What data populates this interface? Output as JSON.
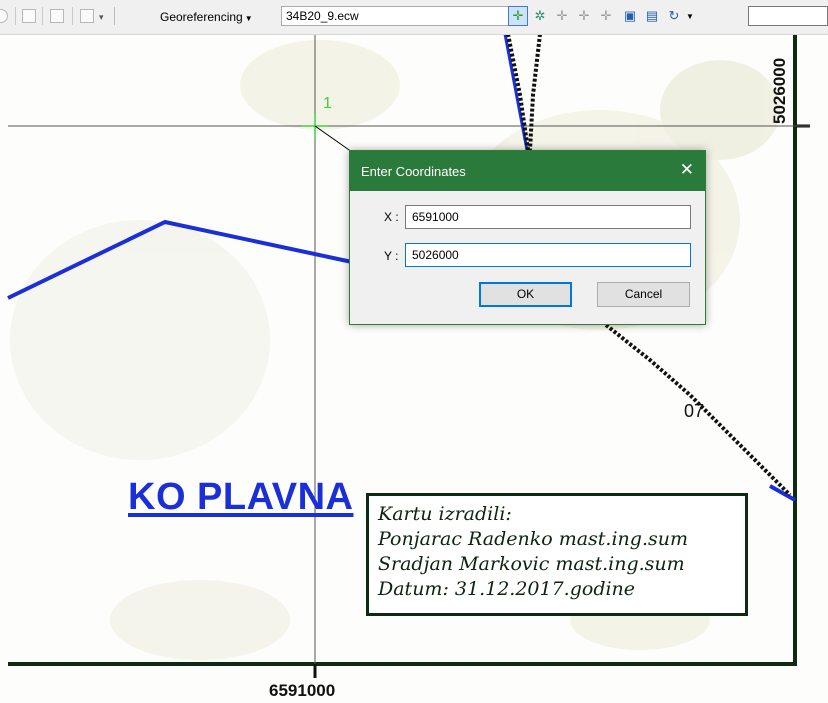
{
  "toolbar": {
    "georeferencing_label": "Georeferencing",
    "layer_combo_value": "34B20_9.ecw",
    "coordinate_box_value": ""
  },
  "map": {
    "y_coordinate_label": "5026000",
    "x_coordinate_label": "6591000",
    "control_point_label": "1",
    "road_number_label": "07",
    "area_title": "KO PLAVNA",
    "credits": {
      "line1": "Kartu izradili:",
      "line2": "Ponjarac Radenko mast.ing.sum",
      "line3": "Sradjan Markovic mast.ing.sum",
      "line4": "Datum: 31.12.2017.godine"
    },
    "colors": {
      "road_blue": "#1b2fd8",
      "frame_green": "#0d2a12",
      "control_point_green": "#3fd13f"
    }
  },
  "dialog": {
    "title": "Enter Coordinates",
    "x_label": "X :",
    "x_value": "6591000",
    "y_label": "Y :",
    "y_value": "5026000",
    "ok_label": "OK",
    "cancel_label": "Cancel",
    "title_bar_color": "#2a7a3b"
  }
}
